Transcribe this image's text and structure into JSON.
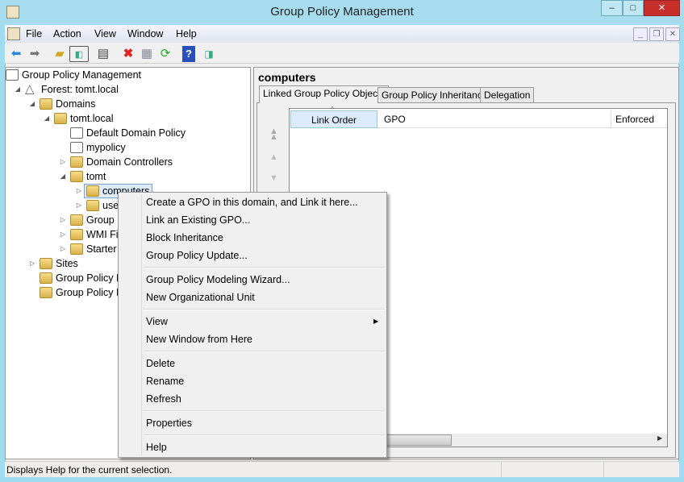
{
  "window": {
    "title": "Group Policy Management",
    "minimize": "–",
    "maximize": "□",
    "close": "✕"
  },
  "menubar": [
    "File",
    "Action",
    "View",
    "Window",
    "Help"
  ],
  "toolbar": [
    "back-icon",
    "forward-icon",
    "up-folder-icon",
    "show-hide-console-tree-icon",
    "clipboard-icon",
    "delete-icon",
    "properties-icon",
    "refresh-icon",
    "help-icon",
    "action-pane-icon"
  ],
  "tree": [
    {
      "label": "Group Policy Management",
      "level": 0,
      "expander": ""
    },
    {
      "label": "Forest: tomt.local",
      "level": 1,
      "expander": "expanded"
    },
    {
      "label": "Domains",
      "level": 2,
      "expander": "expanded"
    },
    {
      "label": "tomt.local",
      "level": 3,
      "expander": "expanded"
    },
    {
      "label": "Default Domain Policy",
      "level": 4,
      "expander": ""
    },
    {
      "label": "mypolicy",
      "level": 4,
      "expander": ""
    },
    {
      "label": "Domain Controllers",
      "level": 4,
      "expander": "collapsed"
    },
    {
      "label": "tomt",
      "level": 4,
      "expander": "expanded"
    },
    {
      "label": "computers",
      "level": 5,
      "expander": "collapsed",
      "selected": true
    },
    {
      "label": "users",
      "level": 5,
      "expander": "collapsed"
    },
    {
      "label": "Group Policy Objects",
      "level": 4,
      "expander": "collapsed"
    },
    {
      "label": "WMI Filters",
      "level": 4,
      "expander": "collapsed"
    },
    {
      "label": "Starter GPOs",
      "level": 4,
      "expander": "collapsed"
    },
    {
      "label": "Sites",
      "level": 2,
      "expander": "collapsed"
    },
    {
      "label": "Group Policy Modeling",
      "level": 2,
      "expander": ""
    },
    {
      "label": "Group Policy Results",
      "level": 2,
      "expander": ""
    }
  ],
  "details": {
    "title": "computers",
    "tabs": [
      "Linked Group Policy Objects",
      "Group Policy Inheritance",
      "Delegation"
    ],
    "active_tab": 0,
    "columns": [
      "Link Order",
      "GPO",
      "Enforced"
    ],
    "sorted_column": "Link Order"
  },
  "context_menu": [
    [
      {
        "label": "Create a GPO in this domain, and Link it here..."
      },
      {
        "label": "Link an Existing GPO..."
      },
      {
        "label": "Block Inheritance"
      },
      {
        "label": "Group Policy Update..."
      }
    ],
    [
      {
        "label": "Group Policy Modeling Wizard..."
      },
      {
        "label": "New Organizational Unit"
      }
    ],
    [
      {
        "label": "View",
        "submenu": true
      },
      {
        "label": "New Window from Here"
      }
    ],
    [
      {
        "label": "Delete"
      },
      {
        "label": "Rename"
      },
      {
        "label": "Refresh"
      }
    ],
    [
      {
        "label": "Properties"
      }
    ],
    [
      {
        "label": "Help"
      }
    ]
  ],
  "status": {
    "text": "Displays Help for the current selection."
  }
}
